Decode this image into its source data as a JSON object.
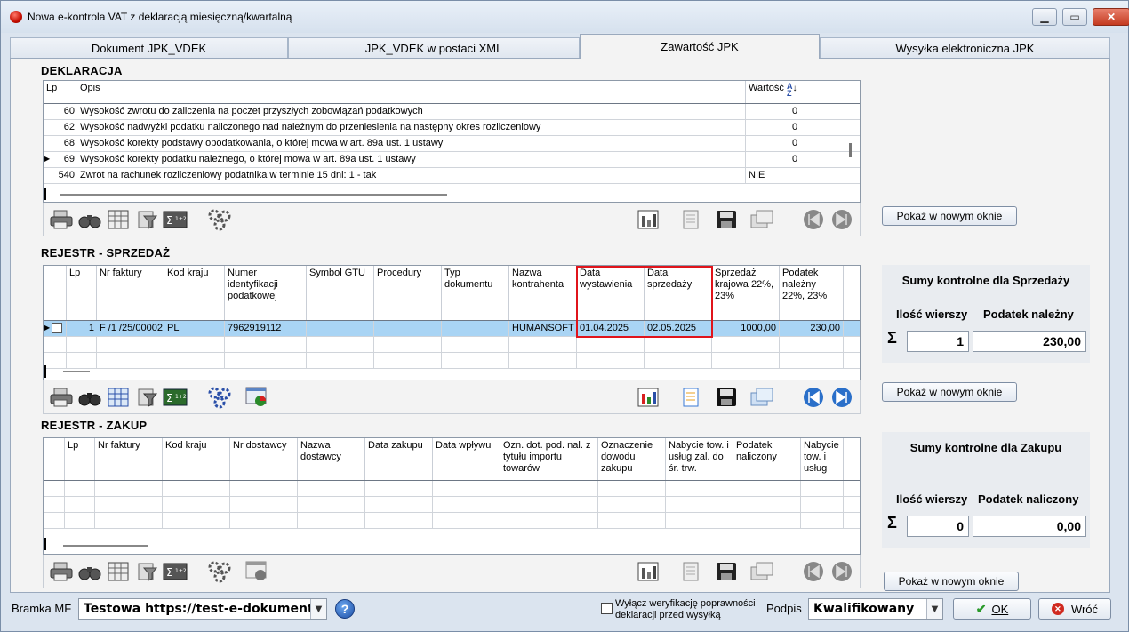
{
  "window": {
    "title": "Nowa e-kontrola VAT z deklaracją miesięczną/kwartalną"
  },
  "tabs": [
    "Dokument JPK_VDEK",
    "JPK_VDEK w postaci XML",
    "Zawartość JPK",
    "Wysyłka elektroniczna JPK"
  ],
  "deklaracja": {
    "title": "DEKLARACJA",
    "headers": {
      "lp": "Lp",
      "opis": "Opis",
      "wartosc": "Wartość"
    },
    "rows": [
      {
        "lp": "60",
        "opis": "Wysokość zwrotu do zaliczenia na poczet przyszłych zobowiązań podatkowych",
        "wartosc": "0"
      },
      {
        "lp": "62",
        "opis": "Wysokość nadwyżki podatku naliczonego nad należnym do przeniesienia na następny okres rozliczeniowy",
        "wartosc": "0"
      },
      {
        "lp": "68",
        "opis": "Wysokość korekty podstawy opodatkowania, o której mowa w art. 89a ust. 1 ustawy",
        "wartosc": "0"
      },
      {
        "lp": "69",
        "opis": "Wysokość korekty podatku należnego, o której mowa w art. 89a ust. 1 ustawy",
        "wartosc": "0"
      },
      {
        "lp": "540",
        "opis": "Zwrot na rachunek rozliczeniowy podatnika w terminie 15 dni: 1 - tak",
        "wartosc": "NIE"
      }
    ],
    "show_button": "Pokaż w nowym oknie"
  },
  "sprzedaz": {
    "title": "REJESTR - SPRZEDAŻ",
    "headers": [
      "Lp",
      "Nr faktury",
      "Kod kraju",
      "Numer identyfikacji podatkowej",
      "Symbol GTU",
      "Procedury",
      "Typ dokumentu",
      "Nazwa kontrahenta",
      "Data wystawienia",
      "Data sprzedaży",
      "Sprzedaż krajowa 22%, 23%",
      "Podatek należny 22%, 23%"
    ],
    "row": {
      "lp": "1",
      "nr": "F /1 /25/00002",
      "kraj": "PL",
      "nip": "7962919112",
      "gtu": "",
      "proc": "",
      "typ": "",
      "kontrahent": "HUMANSOFT Sp. z o.o.",
      "data_wyst": "01.04.2025",
      "data_sprz": "02.05.2025",
      "sprzedaz": "1000,00",
      "podatek": "230,00"
    },
    "show_button": "Pokaż w nowym oknie",
    "sums": {
      "title": "Sumy kontrolne dla Sprzedaży",
      "col1": "Ilość wierszy",
      "col2": "Podatek należny",
      "count": "1",
      "tax": "230,00"
    }
  },
  "zakup": {
    "title": "REJESTR - ZAKUP",
    "headers": [
      "Lp",
      "Nr faktury",
      "Kod kraju",
      "Nr dostawcy",
      "Nazwa dostawcy",
      "Data zakupu",
      "Data wpływu",
      "Ozn. dot. pod. nal. z tytułu importu towarów",
      "Oznaczenie dowodu zakupu",
      "Nabycie tow. i usług zal. do śr. trw.",
      "Podatek naliczony",
      "Nabycie tow. i usług"
    ],
    "show_button": "Pokaż w nowym oknie",
    "sums": {
      "title": "Sumy kontrolne dla Zakupu",
      "col1": "Ilość wierszy",
      "col2": "Podatek naliczony",
      "count": "0",
      "tax": "0,00"
    }
  },
  "bottom": {
    "bramka_label": "Bramka MF",
    "bramka_value": "Testowa https://test-e-dokumenty.mf.gov.pl",
    "verify_label": "Wyłącz weryfikację poprawności deklaracji przed wysyłką",
    "podpis_label": "Podpis",
    "podpis_value": "Kwalifikowany",
    "ok": "OK",
    "back": "Wróć"
  },
  "colors": {
    "selection": "#a9d4f4",
    "highlight": "#e0141b",
    "accent": "#2a6fc9"
  }
}
